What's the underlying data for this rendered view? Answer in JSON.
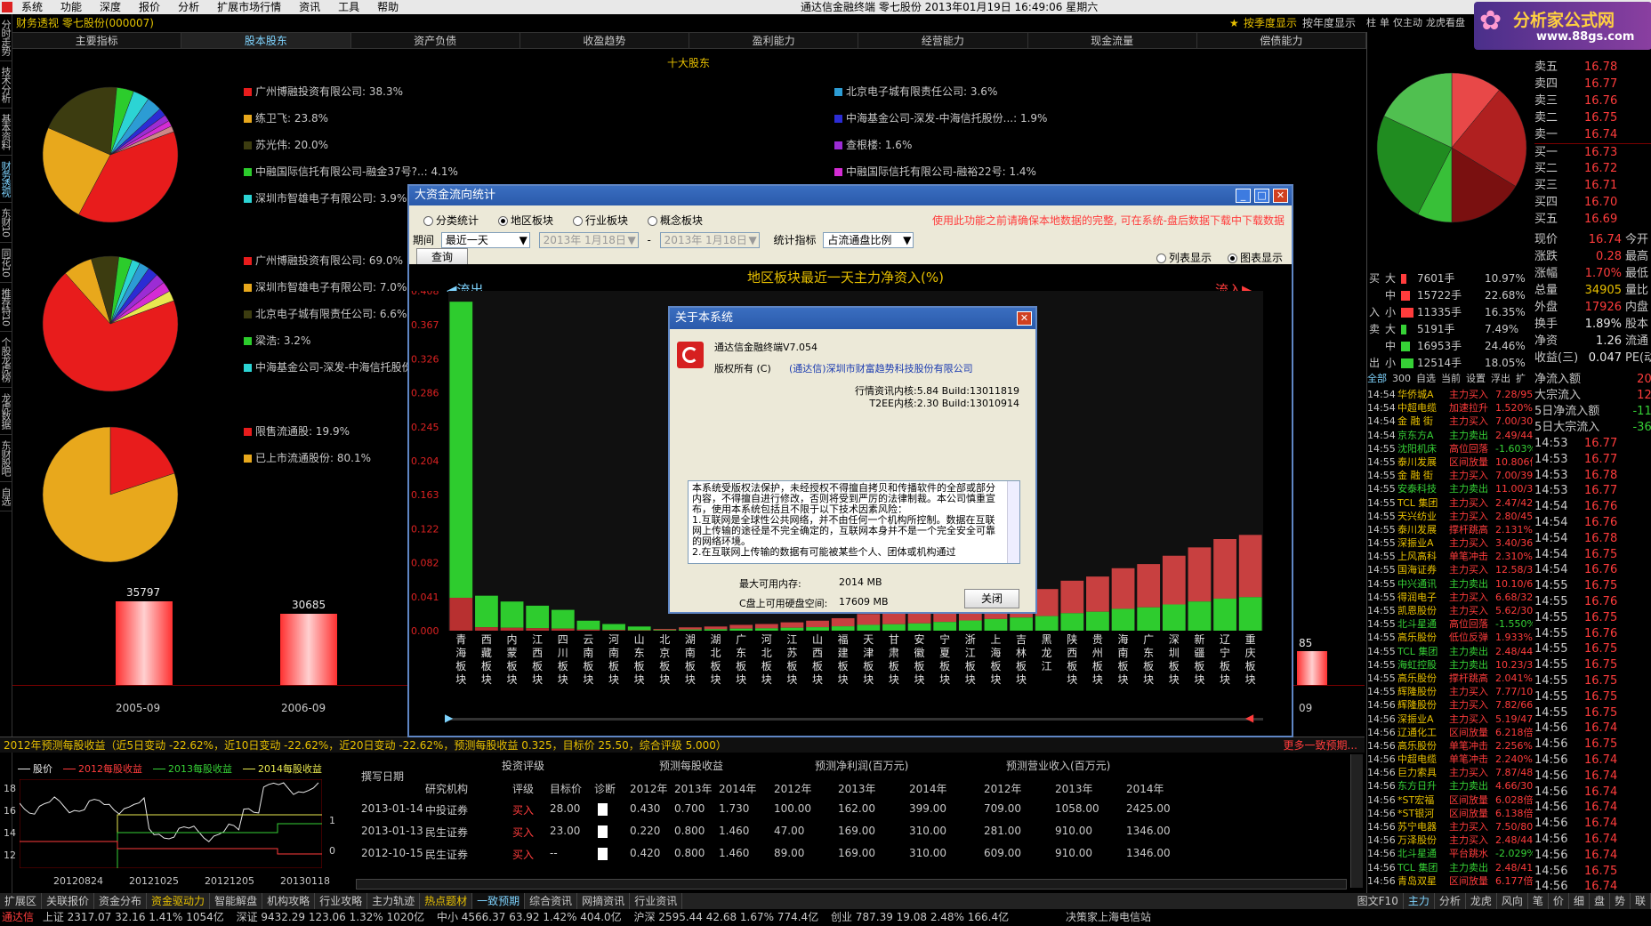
{
  "menu": [
    "系统",
    "功能",
    "深度",
    "报价",
    "分析",
    "扩展市场行情",
    "资讯",
    "工具",
    "帮助"
  ],
  "window_title": "通达信金融终端  零七股份  2013年01月19日  16:49:06  星期六",
  "left_tabs": [
    "分时走势",
    "技术分析",
    "基本资料",
    "财务透视",
    "东财10",
    "同花10",
    "推荐特10",
    "个股龙虎榜",
    "龙虎数据",
    "东财股吧",
    "自选"
  ],
  "header": {
    "title": "财务透视  零七股份(000007)",
    "right_links": [
      "按季度显示",
      "按年度显示"
    ],
    "right_tabs": [
      "柱",
      "单",
      "仅主动",
      "龙虎看盘"
    ]
  },
  "nav_tabs": [
    "主要指标",
    "股本股东",
    "资产负债",
    "收盈趋势",
    "盈利能力",
    "经营能力",
    "现金流量",
    "偿债能力"
  ],
  "section_title": "十大股东",
  "pie1_legend_left": [
    {
      "label": "广州博融投资有限公司: 38.3%",
      "color": "#e81c1c"
    },
    {
      "label": "练卫飞: 23.8%",
      "color": "#e8a81c"
    },
    {
      "label": "苏光伟: 20.0%",
      "color": "#3c3c10"
    },
    {
      "label": "中融国际信托有限公司-融金37号?..: 4.1%",
      "color": "#2ccc2c"
    },
    {
      "label": "深圳市智雄电子有限公司: 3.9%",
      "color": "#2cd4d4"
    }
  ],
  "pie1_legend_right": [
    {
      "label": "北京电子城有限责任公司: 3.6%",
      "color": "#2c9cd4"
    },
    {
      "label": "中海基金公司-深发-中海信托股份...: 1.9%",
      "color": "#2c2cd4"
    },
    {
      "label": "查根楼: 1.6%",
      "color": "#9c2cd4"
    },
    {
      "label": "中融国际信托有限公司-融裕22号: 1.4%",
      "color": "#d42cd4"
    }
  ],
  "pie2_legend": [
    {
      "label": "广州博融投资有限公司: 69.0%",
      "color": "#e81c1c"
    },
    {
      "label": "深圳市智雄电子有限公司: 7.0%",
      "color": "#e8a81c"
    },
    {
      "label": "北京电子城有限责任公司: 6.6%",
      "color": "#3c3c10"
    },
    {
      "label": "梁浩: 3.2%",
      "color": "#2ccc2c"
    },
    {
      "label": "中海基金公司-深发-中海信托股份",
      "color": "#2cd4d4"
    }
  ],
  "pie3_legend": [
    {
      "label": "限售流通股: 19.9%",
      "color": "#e81c1c"
    },
    {
      "label": "已上市流通股份: 80.1%",
      "color": "#e8a81c"
    }
  ],
  "share_bars": [
    {
      "label": "2005-09",
      "value": "35797"
    },
    {
      "label": "2006-09",
      "value": "30685"
    }
  ],
  "share_bar_right_label": "09",
  "share_bar_right_value": "85",
  "dialog": {
    "title": "大资金流向统计",
    "radios": [
      "分类统计",
      "地区板块",
      "行业板块",
      "概念板块"
    ],
    "radio_selected": "地区板块",
    "warning": "使用此功能之前请确保本地数据的完整, 可在系统-盘后数据下载中下载数据",
    "period_label": "期间",
    "period_value": "最近一天",
    "date_from": "2013年 1月18日",
    "date_to": "2013年 1月18日",
    "metric_label": "统计指标",
    "metric_value": "占流通盘比例",
    "query_button": "查询",
    "view_options": [
      "列表显示",
      "图表显示"
    ],
    "view_selected": "图表显示",
    "outflow_label": "流出",
    "inflow_label": "流入"
  },
  "chart_data": {
    "type": "bar",
    "title": "地区板块最近一天主力净资入(%)",
    "ylim": [
      0,
      0.408
    ],
    "yticks": [
      "0.408",
      "0.367",
      "0.326",
      "0.286",
      "0.245",
      "0.204",
      "0.163",
      "0.122",
      "0.082",
      "0.041",
      "0.000"
    ],
    "categories": [
      "青海板块",
      "西藏板块",
      "内蒙板块",
      "江西板块",
      "四川板块",
      "云南板块",
      "河南板块",
      "山东板块",
      "北京板块",
      "湖南板块",
      "湖北板块",
      "广东板块",
      "河北板块",
      "江苏板块",
      "山西板块",
      "福建板块",
      "天津板块",
      "甘肃板块",
      "安徽板块",
      "宁夏板块",
      "浙江板块",
      "上海板块",
      "吉林板块",
      "黑龙江",
      "陕西板块",
      "贵州板块",
      "海南板块",
      "广东板块",
      "深圳板块",
      "新疆板块",
      "辽宁板块",
      "重庆板块"
    ],
    "values": [
      -0.395,
      -0.042,
      -0.035,
      -0.03,
      -0.025,
      -0.012,
      -0.008,
      -0.005,
      0.002,
      0.004,
      0.005,
      0.007,
      0.008,
      0.01,
      0.012,
      0.015,
      0.02,
      0.022,
      0.025,
      0.03,
      0.035,
      0.04,
      0.045,
      0.05,
      0.06,
      0.065,
      0.075,
      0.08,
      0.09,
      0.1,
      0.11,
      0.115
    ]
  },
  "about": {
    "title": "关于本系统",
    "product": "通达信金融终端V7.054",
    "copyright_label": "版权所有 (C)",
    "copyright_owner": "(通达信)深圳市财富趋势科技股份有限公司",
    "kernel1": "行情资讯内核:5.84 Build:13011819",
    "kernel2": "T2EE内核:2.30 Build:13010914",
    "notice": "本系统受版权法保护，未经授权不得擅自拷贝和传播软件的全部或部分内容，不得擅自进行修改，否则将受到严厉的法律制裁。本公司慎重宣布，使用本系统包括且不限于以下技术因素风险：\n1.互联网是全球性公共网络，并不由任何一个机构所控制。数据在互联网上传输的途径是不完全确定的，互联网本身并不是一个完全安全可靠的网络环境。\n2.在互联网上传输的数据有可能被某些个人、团体或机构通过",
    "mem_label": "最大可用内存:",
    "mem_value": "2014 MB",
    "disk_label": "C盘上可用硬盘空间:",
    "disk_value": "17609 MB",
    "close_button": "关闭"
  },
  "forecast_strip": "2012年预测每股收益（近5日变动 -22.62%，近10日变动 -22.62%，近20日变动 -22.62%，预测每股收益 0.325，目标价 25.50，综合评级 5.000）",
  "forecast_more": "更多一致预期...",
  "mini_legend": [
    "股价",
    "2012每股收益",
    "2013每股收益",
    "2014每股收益"
  ],
  "mini_xlabels": [
    "20120824",
    "20121025",
    "20121205",
    "20130118"
  ],
  "mini_ylabels": [
    "18",
    "16",
    "14",
    "12"
  ],
  "mini_right_ylabels": [
    "1",
    "0"
  ],
  "forecast_table": {
    "group_headers": [
      "投资评级",
      "预测每股收益",
      "预测净利润(百万元)",
      "预测营业收入(百万元)"
    ],
    "columns": [
      "撰写日期",
      "研究机构",
      "评级",
      "目标价",
      "诊断",
      "2012年",
      "2013年",
      "2014年",
      "2012年",
      "2013年",
      "2014年",
      "2012年",
      "2013年",
      "2014年"
    ],
    "rows": [
      [
        "2013-01-14",
        "中投证券",
        "买入",
        "28.00",
        "",
        "0.430",
        "0.700",
        "1.730",
        "100.00",
        "162.00",
        "399.00",
        "709.00",
        "1058.00",
        "2425.00"
      ],
      [
        "2013-01-13",
        "民生证券",
        "买入",
        "23.00",
        "",
        "0.220",
        "0.800",
        "1.460",
        "47.00",
        "169.00",
        "310.00",
        "281.00",
        "910.00",
        "1346.00"
      ],
      [
        "2012-10-15",
        "民生证券",
        "买入",
        "--",
        "",
        "0.420",
        "0.800",
        "1.460",
        "89.00",
        "169.00",
        "310.00",
        "609.00",
        "910.00",
        "1346.00"
      ]
    ]
  },
  "right_panel": {
    "logo": "分析家公式网",
    "logo_url": "www.88gs.com",
    "orderbook": [
      {
        "label": "卖五",
        "price": "16.78"
      },
      {
        "label": "卖四",
        "price": "16.77"
      },
      {
        "label": "卖三",
        "price": "16.76"
      },
      {
        "label": "卖二",
        "price": "16.75"
      },
      {
        "label": "卖一",
        "price": "16.74"
      },
      {
        "label": "买一",
        "price": "16.73"
      },
      {
        "label": "买二",
        "price": "16.72"
      },
      {
        "label": "买三",
        "price": "16.71"
      },
      {
        "label": "买四",
        "price": "16.70"
      },
      {
        "label": "买五",
        "price": "16.69"
      }
    ],
    "stats": [
      {
        "label": "现价",
        "value": "16.74",
        "r": "今开"
      },
      {
        "label": "涨跌",
        "value": "0.28",
        "r": "最高"
      },
      {
        "label": "涨幅",
        "value": "1.70%",
        "r": "最低"
      },
      {
        "label": "总量",
        "value": "34905",
        "r": "量比"
      },
      {
        "label": "外盘",
        "value": "17926",
        "r": "内盘"
      },
      {
        "label": "换手",
        "value": "1.89%",
        "r": "股本"
      },
      {
        "label": "净资",
        "value": "1.26",
        "r": "流通"
      },
      {
        "label": "收益(三)",
        "value": "0.047",
        "r": "PE(动"
      }
    ],
    "flow": [
      {
        "side": "买",
        "size": "大",
        "vol": "7601手",
        "pct": "10.97%"
      },
      {
        "side": "",
        "size": "中",
        "vol": "15722手",
        "pct": "22.68%"
      },
      {
        "side": "入",
        "size": "小",
        "vol": "11335手",
        "pct": "16.35%"
      },
      {
        "side": "卖",
        "size": "大",
        "vol": "5191手",
        "pct": "7.49%"
      },
      {
        "side": "",
        "size": "中",
        "vol": "16953手",
        "pct": "24.46%"
      },
      {
        "side": "出",
        "size": "小",
        "vol": "12514手",
        "pct": "18.05%"
      }
    ],
    "flow_right": [
      {
        "label": "净流入额",
        "value": "209"
      },
      {
        "label": "大宗流入",
        "value": "127"
      },
      {
        "label": "5日净流入额",
        "value": "-116"
      },
      {
        "label": "5日大宗流入",
        "value": "-365"
      }
    ],
    "monitor_tabs": [
      "全部",
      "300",
      "自选",
      "当前",
      "设置",
      "浮出",
      "扩"
    ],
    "monitor": [
      [
        "14:54",
        "华侨城A",
        "主力买入",
        "7.28/95"
      ],
      [
        "14:54",
        "中超电缆",
        "加速拉升",
        "1.520%"
      ],
      [
        "14:54",
        "金 融 街",
        "主力买入",
        "7.00/30"
      ],
      [
        "14:54",
        "京东方A",
        "主力卖出",
        "2.49/44"
      ],
      [
        "14:55",
        "沈阳机床",
        "高位回落",
        "-1.603%"
      ],
      [
        "14:55",
        "泰川发展",
        "区间放量",
        "10.806倍"
      ],
      [
        "14:55",
        "金 融 街",
        "主力买入",
        "7.00/39"
      ],
      [
        "14:55",
        "安泰科技",
        "主力卖出",
        "11.00/3"
      ],
      [
        "14:55",
        "TCL 集团",
        "主力买入",
        "2.47/42"
      ],
      [
        "14:55",
        "天兴纺业",
        "主力买入",
        "2.80/45"
      ],
      [
        "14:55",
        "泰川发展",
        "撑杆跳高",
        "2.131%"
      ],
      [
        "14:55",
        "深振业A",
        "主力买入",
        "3.40/36"
      ],
      [
        "14:55",
        "上风高科",
        "单笔冲击",
        "2.310%"
      ],
      [
        "14:55",
        "国海证券",
        "主力买入",
        "12.58/3"
      ],
      [
        "14:55",
        "中兴通讯",
        "主力卖出",
        "10.10/6"
      ],
      [
        "14:55",
        "得润电子",
        "主力买入",
        "6.68/32"
      ],
      [
        "14:55",
        "凯恩股份",
        "主力买入",
        "5.62/30"
      ],
      [
        "14:55",
        "北斗星通",
        "高位回落",
        "-1.550%"
      ],
      [
        "14:55",
        "高乐股份",
        "低位反弹",
        "1.933%"
      ],
      [
        "14:55",
        "TCL 集团",
        "主力卖出",
        "2.48/44"
      ],
      [
        "14:55",
        "海虹控股",
        "主力卖出",
        "10.23/3"
      ],
      [
        "14:55",
        "高乐股份",
        "撑杆跳高",
        "2.041%"
      ],
      [
        "14:55",
        "辉隆股份",
        "主力买入",
        "7.77/10"
      ],
      [
        "14:56",
        "辉隆股份",
        "主力买入",
        "7.82/66"
      ],
      [
        "14:56",
        "深振业A",
        "主力买入",
        "5.19/47"
      ],
      [
        "14:56",
        "辽通化工",
        "区间放量",
        "6.218倍"
      ],
      [
        "14:56",
        "高乐股份",
        "单笔冲击",
        "2.256%"
      ],
      [
        "14:56",
        "中超电缆",
        "单笔冲击",
        "2.240%"
      ],
      [
        "14:56",
        "巨力索具",
        "主力买入",
        "7.87/48"
      ],
      [
        "14:56",
        "东方日升",
        "主力卖出",
        "4.66/30"
      ],
      [
        "14:56",
        "*ST宏福",
        "区间放量",
        "6.028倍"
      ],
      [
        "14:56",
        "*ST银河",
        "区间放量",
        "6.138倍"
      ],
      [
        "14:56",
        "苏宁电器",
        "主力买入",
        "7.50/80"
      ],
      [
        "14:56",
        "万泽股份",
        "主力买入",
        "2.48/44"
      ],
      [
        "14:56",
        "北斗星通",
        "平台跳水",
        "-2.029%"
      ],
      [
        "14:56",
        "TCL 集团",
        "主力卖出",
        "2.48/41"
      ],
      [
        "14:56",
        "青岛双星",
        "区间放量",
        "6.177倍"
      ]
    ],
    "ticks": [
      [
        "14:53",
        "16.77"
      ],
      [
        "14:53",
        "16.77"
      ],
      [
        "14:53",
        "16.78"
      ],
      [
        "14:53",
        "16.77"
      ],
      [
        "14:54",
        "16.76"
      ],
      [
        "14:54",
        "16.76"
      ],
      [
        "14:54",
        "16.78"
      ],
      [
        "14:54",
        "16.75"
      ],
      [
        "14:54",
        "16.76"
      ],
      [
        "14:55",
        "16.75"
      ],
      [
        "14:55",
        "16.76"
      ],
      [
        "14:55",
        "16.75"
      ],
      [
        "14:55",
        "16.76"
      ],
      [
        "14:55",
        "16.75"
      ],
      [
        "14:55",
        "16.75"
      ],
      [
        "14:55",
        "16.75"
      ],
      [
        "14:55",
        "16.75"
      ],
      [
        "14:55",
        "16.75"
      ],
      [
        "14:56",
        "16.74"
      ],
      [
        "14:56",
        "16.75"
      ],
      [
        "14:56",
        "16.74"
      ],
      [
        "14:56",
        "16.74"
      ],
      [
        "14:56",
        "16.74"
      ],
      [
        "14:56",
        "16.74"
      ],
      [
        "14:56",
        "16.74"
      ],
      [
        "14:56",
        "16.74"
      ],
      [
        "14:56",
        "16.74"
      ],
      [
        "14:56",
        "16.75"
      ],
      [
        "14:56",
        "16.74"
      ],
      [
        "15:00",
        "16.74"
      ]
    ],
    "bottom_tabs": [
      "主力",
      "分析",
      "龙虎",
      "风向",
      "笔",
      "价",
      "细",
      "盘",
      "势",
      "联"
    ]
  },
  "bottom_tabs": [
    "扩展区",
    "关联报价",
    "资金分布",
    "资金驱动力",
    "智能解盘",
    "机构攻略",
    "行业攻略",
    "主力轨迹",
    "热点题材",
    "一致预期",
    "综合资讯",
    "网摘资讯",
    "行业资讯"
  ],
  "bottom_tab_right": "图文F10",
  "status": {
    "brand": "通达信",
    "sh": "上证 2317.07  32.16  1.41%  1054亿",
    "sz": "深证 9432.29  123.06  1.32%  1020亿",
    "zx": "中小 4566.37  63.92  1.42%  404.0亿",
    "hs": "沪深 2595.44  42.68  1.67%  774.4亿",
    "cy": "创业 787.39  19.08  2.48%  166.4亿",
    "msg": "决策家上海电信站"
  }
}
